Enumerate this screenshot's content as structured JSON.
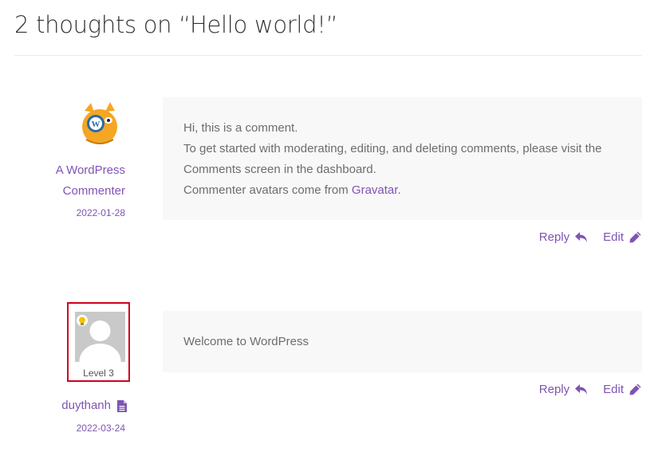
{
  "comments_title": "2 thoughts on “Hello world!”",
  "comments": [
    {
      "author": {
        "line1": "A WordPress",
        "line2": "Commenter"
      },
      "date": "2022-01-28",
      "avatar_icon": "wapuu-avatar-icon",
      "body": {
        "line1": "Hi, this is a comment.",
        "line2": "To get started with moderating, editing, and deleting comments, please visit the",
        "line3": "Comments screen in the dashboard.",
        "line4_prefix": "Commenter avatars come from ",
        "line4_link": "Gravatar",
        "line4_suffix": "."
      },
      "actions": {
        "reply": "Reply",
        "edit": "Edit"
      }
    },
    {
      "author": {
        "name": "duythanh"
      },
      "author_badge_icon": "document-icon",
      "date": "2022-03-24",
      "avatar_icon": "default-user-avatar-icon",
      "level_badge": "Level 3",
      "body": {
        "line1": "Welcome to WordPress"
      },
      "actions": {
        "reply": "Reply",
        "edit": "Edit"
      }
    }
  ],
  "colors": {
    "link": "#7f54b3",
    "bubble": "#f8f8f8",
    "highlight_border": "#d0021b"
  }
}
